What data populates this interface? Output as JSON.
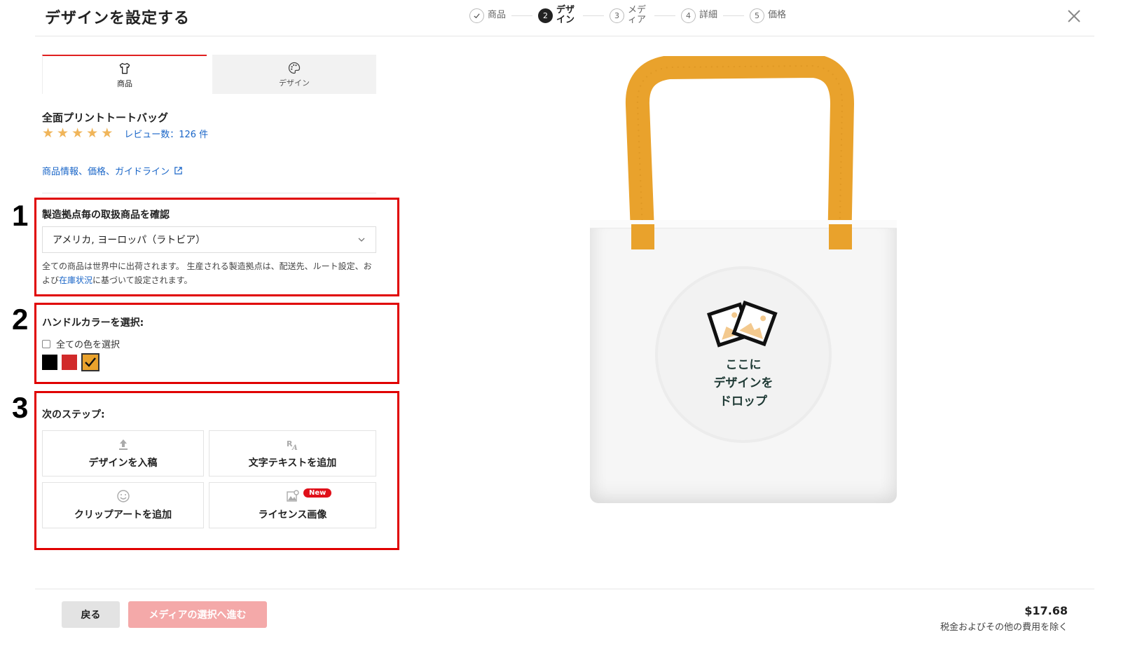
{
  "header": {
    "title": "デザインを設定する",
    "steps": [
      {
        "num": "",
        "label": "商品",
        "state": "done"
      },
      {
        "num": "2",
        "label": "デザイン",
        "state": "active"
      },
      {
        "num": "3",
        "label": "メディア",
        "state": "todo"
      },
      {
        "num": "4",
        "label": "詳細",
        "state": "todo"
      },
      {
        "num": "5",
        "label": "価格",
        "state": "todo"
      }
    ]
  },
  "tabs": {
    "product": "商品",
    "design": "デザイン"
  },
  "product": {
    "name": "全面プリントトートバッグ",
    "rating": 5,
    "reviews": "レビュー数：126 件",
    "info_link": "商品情報、価格、ガイドライン"
  },
  "annotations": [
    "1",
    "2",
    "3"
  ],
  "region": {
    "title": "製造拠点毎の取扱商品を確認",
    "selected": "アメリカ, ヨーロッパ（ラトビア）",
    "note_before": "全ての商品は世界中に出荷されます。 生産される製造拠点は、配送先、ルート設定、および",
    "note_link": "在庫状況",
    "note_after": "に基づいて設定されます。"
  },
  "handle_color": {
    "title": "ハンドルカラーを選択:",
    "select_all": "全ての色を選択",
    "colors": [
      "#000000",
      "#d12a2a",
      "#e9a22c"
    ],
    "selected": "#e9a22c"
  },
  "next_steps": {
    "title": "次のステップ:",
    "upload": "デザインを入稿",
    "add_text": "文字テキストを追加",
    "add_clipart": "クリップアートを追加",
    "licensed_image": "ライセンス画像",
    "new_badge": "New"
  },
  "preview": {
    "drop_line1": "ここに",
    "drop_line2": "デザインを",
    "drop_line3": "ドロップ",
    "handle_color": "#e9a22c"
  },
  "footer": {
    "back": "戻る",
    "next": "メディアの選択へ進む",
    "price": "$17.68",
    "price_note": "税金およびその他の費用を除く"
  }
}
